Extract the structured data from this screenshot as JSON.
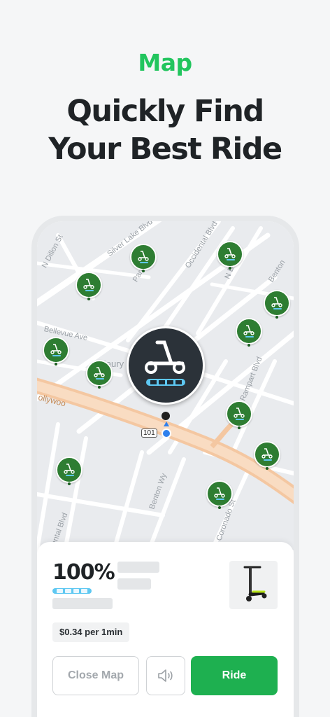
{
  "header": {
    "eyebrow": "Map",
    "title_line1": "Quickly Find",
    "title_line2": "Your Best Ride"
  },
  "map": {
    "street_labels": [
      "N Dillon St",
      "Silver Lake Blvd",
      "Occidental Blvd",
      "N Benton",
      "Benton",
      "Bellevue Ave",
      "Parkman",
      "Maury",
      "ollywoo",
      "101",
      "Rampart Blvd",
      "Benton Wy",
      "Coronado St",
      "dental Blvd"
    ],
    "scooter_pins": 12,
    "selected_vehicle": "scooter"
  },
  "vehicle_sheet": {
    "battery_percent": "100%",
    "battery_level": 1.0,
    "price": "$0.34 per 1min",
    "close_label": "Close Map",
    "ride_label": "Ride",
    "sound_icon": "speaker-icon"
  },
  "colors": {
    "accent": "#22c55e",
    "ride_button": "#1eb050",
    "pin_green": "#2e7d32",
    "battery_blue": "#5ec8f2"
  }
}
